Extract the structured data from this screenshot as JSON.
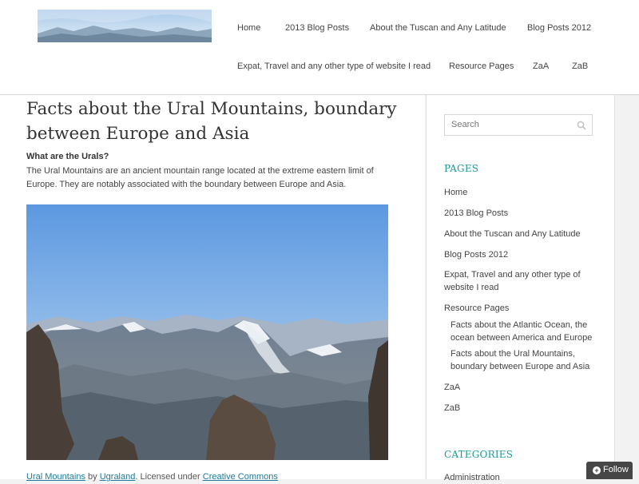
{
  "nav": {
    "row1": [
      "Home",
      "2013 Blog Posts",
      "About the Tuscan and Any Latitude",
      "Blog Posts 2012"
    ],
    "row2": [
      "Expat, Travel and any other type of website I read",
      "Resource Pages",
      "ZaA",
      "ZaB"
    ]
  },
  "post": {
    "title": "Facts about the Ural Mountains, boundary between Europe and Asia",
    "question": "What are the Urals?",
    "intro": "The Ural Mountains are an ancient mountain range located at the extreme eastern limit of Europe. They are notably associated with the boundary between Europe and Asia.",
    "caption": {
      "link1": "Ural Mountains",
      "by": " by ",
      "link2": "Ugraland",
      "licensed": ". Licensed under ",
      "link3": "Creative Commons"
    }
  },
  "sidebar": {
    "search_placeholder": "Search",
    "pages_title": "PAGES",
    "pages": [
      "Home",
      "2013 Blog Posts",
      "About the Tuscan and Any Latitude",
      "Blog Posts 2012",
      "Expat, Travel and any other type of website I read",
      "Resource Pages"
    ],
    "subpages": [
      "Facts about the Atlantic Ocean, the ocean between America and Europe",
      "Facts about the Ural Mountains, boundary between Europe and Asia"
    ],
    "pages_after": [
      "ZaA",
      "ZaB"
    ],
    "categories_title": "CATEGORIES",
    "categories": [
      "Administration"
    ]
  },
  "follow_label": "Follow",
  "colors": {
    "accent": "#1b9a9a",
    "link": "#1b7a9a",
    "follow_bg": "#464646"
  }
}
